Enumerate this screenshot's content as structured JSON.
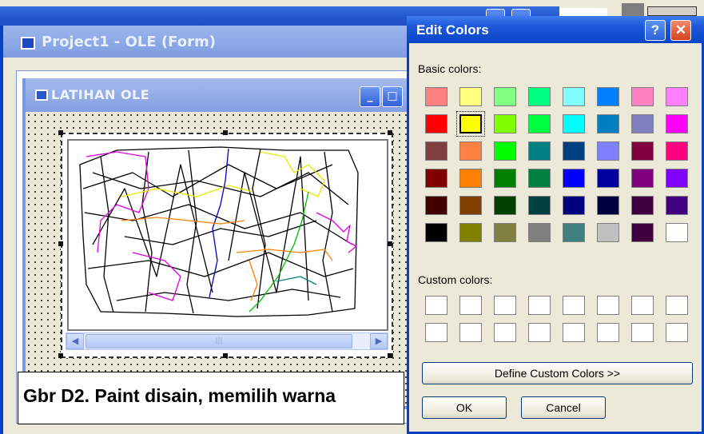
{
  "project_window": {
    "title": "Project1 - OLE (Form)"
  },
  "form_window": {
    "title": "LATIHAN OLE",
    "minimize": "_",
    "maximize": "□"
  },
  "ole_scroll": {
    "left_arrow": "◀",
    "right_arrow": "▶",
    "thumb_grip": "|||"
  },
  "caption": "Gbr D2. Paint disain, memilih warna",
  "dialog": {
    "title": "Edit Colors",
    "help": "?",
    "close": "✕",
    "basic_label": "Basic colors:",
    "custom_label": "Custom colors:",
    "define_button": "Define Custom Colors >>",
    "ok_button": "OK",
    "cancel_button": "Cancel",
    "selected_color_index": 9,
    "basic_colors": [
      "#ff8080",
      "#ffff80",
      "#80ff80",
      "#00ff80",
      "#80ffff",
      "#0080ff",
      "#ff80c0",
      "#ff80ff",
      "#ff0000",
      "#ffff00",
      "#80ff00",
      "#00ff40",
      "#00ffff",
      "#0080c0",
      "#8080c0",
      "#ff00ff",
      "#804040",
      "#ff8040",
      "#00ff00",
      "#008080",
      "#004080",
      "#8080ff",
      "#800040",
      "#ff0080",
      "#800000",
      "#ff8000",
      "#008000",
      "#008040",
      "#0000ff",
      "#0000a0",
      "#800080",
      "#8000ff",
      "#400000",
      "#804000",
      "#004000",
      "#004040",
      "#000080",
      "#000040",
      "#400040",
      "#400080",
      "#000000",
      "#808000",
      "#808040",
      "#808080",
      "#408080",
      "#c0c0c0",
      "#400040",
      "#ffffff"
    ],
    "custom_colors": [
      "#ffffff",
      "#ffffff",
      "#ffffff",
      "#ffffff",
      "#ffffff",
      "#ffffff",
      "#ffffff",
      "#ffffff",
      "#ffffff",
      "#ffffff",
      "#ffffff",
      "#ffffff",
      "#ffffff",
      "#ffffff",
      "#ffffff",
      "#ffffff"
    ]
  }
}
